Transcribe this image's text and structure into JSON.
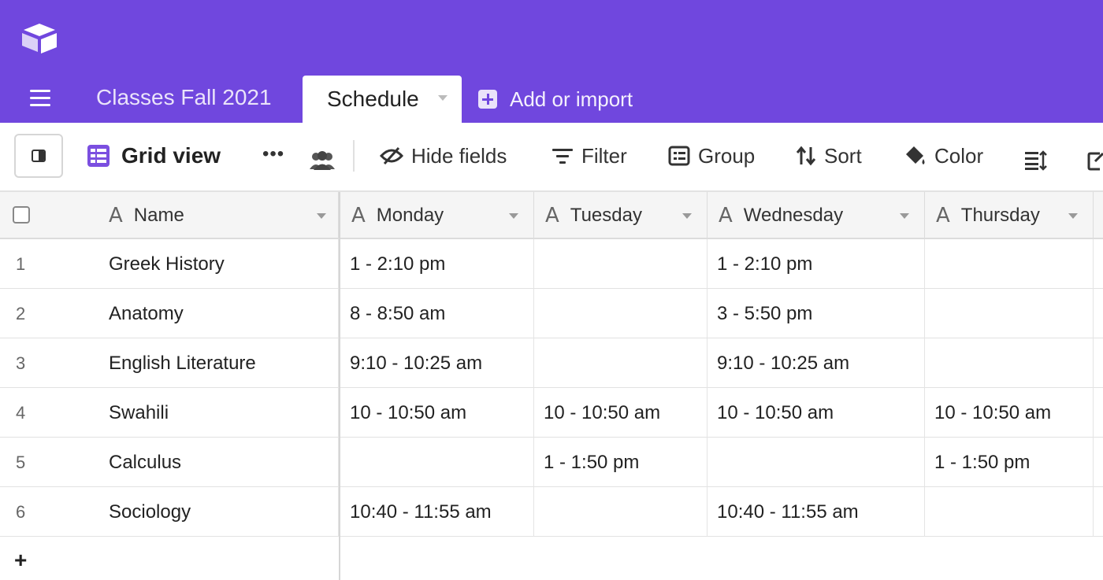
{
  "header": {
    "base_name": "Classes Fall 2021",
    "active_tab": "Schedule",
    "add_import": "Add or import"
  },
  "toolbar": {
    "view_name": "Grid view",
    "more": "•••",
    "hide_fields": "Hide fields",
    "filter": "Filter",
    "group": "Group",
    "sort": "Sort",
    "color": "Color"
  },
  "grid": {
    "columns": [
      "Name",
      "Monday",
      "Tuesday",
      "Wednesday",
      "Thursday"
    ],
    "rows": [
      {
        "num": "1",
        "name": "Greek History",
        "monday": "1 - 2:10 pm",
        "tuesday": "",
        "wednesday": "1 - 2:10 pm",
        "thursday": ""
      },
      {
        "num": "2",
        "name": "Anatomy",
        "monday": "8 - 8:50 am",
        "tuesday": "",
        "wednesday": "3 - 5:50 pm",
        "thursday": ""
      },
      {
        "num": "3",
        "name": "English Literature",
        "monday": "9:10 - 10:25 am",
        "tuesday": "",
        "wednesday": "9:10 - 10:25 am",
        "thursday": ""
      },
      {
        "num": "4",
        "name": "Swahili",
        "monday": "10 - 10:50 am",
        "tuesday": "10 - 10:50 am",
        "wednesday": "10 - 10:50 am",
        "thursday": "10 - 10:50 am"
      },
      {
        "num": "5",
        "name": "Calculus",
        "monday": "",
        "tuesday": "1 - 1:50 pm",
        "wednesday": "",
        "thursday": "1 - 1:50 pm"
      },
      {
        "num": "6",
        "name": "Sociology",
        "monday": "10:40 - 11:55 am",
        "tuesday": "",
        "wednesday": "10:40 - 11:55 am",
        "thursday": ""
      }
    ],
    "add_row": "+"
  },
  "colors": {
    "brand": "#7047de",
    "grid_view_icon": "#7b4fe0"
  },
  "icons": [
    "app-logo-icon",
    "hamburger-menu-icon",
    "add-box-icon",
    "sidebar-toggle-icon",
    "grid-view-icon",
    "collaborators-icon",
    "hide-fields-icon",
    "filter-icon",
    "group-icon",
    "sort-icon",
    "color-bucket-icon",
    "row-height-icon",
    "share-icon",
    "text-field-icon"
  ]
}
